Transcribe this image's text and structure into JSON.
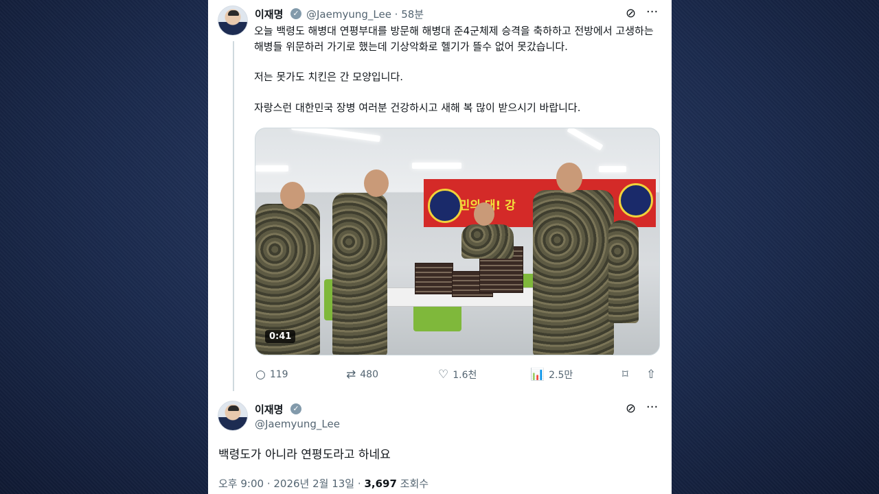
{
  "tweet": {
    "author_name": "이재명",
    "handle_time": "@Jaemyung_Lee · 58분",
    "text_1": "오늘 백령도 해병대 연평부대를 방문해 해병대 준4군체제 승격을 축하하고 전방에서 고생하는 해병들 위문하러 가기로 했는데 기상악화로 헬기가 뜰수 없어 못갔습니다.",
    "text_2": "저는 못가도 치킨은 간 모양입니다.",
    "text_3": "자랑스런 대한민국 장병 여러분 건강하시고 새해 복 많이 받으시기 바랍니다.",
    "stats": {
      "replies": "119",
      "retweets": "480",
      "likes": "1.6천",
      "views": "2.5만"
    }
  },
  "media": {
    "duration": "0:41",
    "banner_text": "국민의  대!  강"
  },
  "reply": {
    "author_name": "이재명",
    "handle": "@Jaemyung_Lee",
    "text": "백령도가 아니라 연평도라고 하네요",
    "timestamp": "오후 9:00 · 2026년 2월 13일",
    "separator": " · ",
    "views_count": "3,697",
    "views_label": "조회수"
  },
  "icons": {
    "verified": "✓",
    "grok": "⊘",
    "more": "···",
    "reply": "○",
    "retweet": "⇄",
    "like": "♡",
    "views": "📊",
    "bookmark": "⌑",
    "share": "⇧"
  },
  "colors": {
    "text_primary": "#0f1419",
    "text_secondary": "#536471",
    "background_page": "#1b2a4d",
    "banner_red": "#d42a28"
  }
}
